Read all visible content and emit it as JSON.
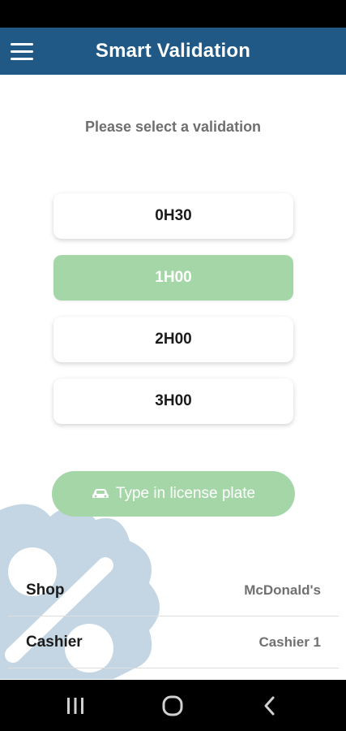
{
  "app_bar": {
    "title": "Smart Validation",
    "color": "#205985",
    "menu_icon": "hamburger-menu-icon"
  },
  "prompt": "Please select a validation",
  "options": [
    {
      "label": "0H30",
      "selected": false
    },
    {
      "label": "1H00",
      "selected": true
    },
    {
      "label": "2H00",
      "selected": false
    },
    {
      "label": "3H00",
      "selected": false
    }
  ],
  "accent_color": "#a5d6a7",
  "plate_button": {
    "label": "Type in license plate",
    "icon": "car-icon"
  },
  "info": [
    {
      "label": "Shop",
      "value": "McDonald's"
    },
    {
      "label": "Cashier",
      "value": "Cashier 1"
    }
  ],
  "nav_bar": {
    "recent_icon": "recent-apps-icon",
    "home_icon": "home-icon",
    "back_icon": "back-icon"
  }
}
